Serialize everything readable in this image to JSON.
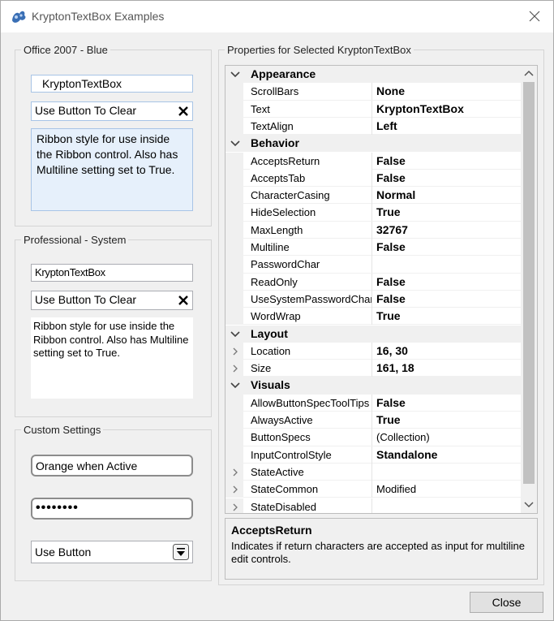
{
  "window": {
    "title": "KryptonTextBox Examples"
  },
  "office_group": {
    "legend": "Office 2007 - Blue",
    "textbox1": "KryptonTextBox",
    "textbox2": "Use Button To Clear",
    "multiline": "Ribbon style for use inside the Ribbon control. Also has Multiline setting set to True."
  },
  "professional_group": {
    "legend": "Professional - System",
    "textbox1": "KryptonTextBox",
    "textbox2": "Use Button To Clear",
    "multiline": "Ribbon style for use inside the Ribbon control. Also has Multiline setting set to True."
  },
  "custom_group": {
    "legend": "Custom Settings",
    "textbox1": "Orange when Active",
    "password": "••••••••",
    "textbox3": "Use Button"
  },
  "properties_group": {
    "legend": "Properties for Selected KryptonTextBox"
  },
  "property_grid": {
    "rows": [
      {
        "kind": "cat",
        "label": "Appearance"
      },
      {
        "kind": "prop",
        "name": "ScrollBars",
        "value": "None",
        "bold": true
      },
      {
        "kind": "prop",
        "name": "Text",
        "value": "KryptonTextBox",
        "bold": true
      },
      {
        "kind": "prop",
        "name": "TextAlign",
        "value": "Left",
        "bold": true
      },
      {
        "kind": "cat",
        "label": "Behavior"
      },
      {
        "kind": "prop",
        "name": "AcceptsReturn",
        "value": "False",
        "bold": true,
        "selected": true
      },
      {
        "kind": "prop",
        "name": "AcceptsTab",
        "value": "False",
        "bold": true
      },
      {
        "kind": "prop",
        "name": "CharacterCasing",
        "value": "Normal",
        "bold": true
      },
      {
        "kind": "prop",
        "name": "HideSelection",
        "value": "True",
        "bold": true
      },
      {
        "kind": "prop",
        "name": "MaxLength",
        "value": "32767",
        "bold": true
      },
      {
        "kind": "prop",
        "name": "Multiline",
        "value": "False",
        "bold": true
      },
      {
        "kind": "prop",
        "name": "PasswordChar",
        "value": "",
        "bold": true
      },
      {
        "kind": "prop",
        "name": "ReadOnly",
        "value": "False",
        "bold": true
      },
      {
        "kind": "prop",
        "name": "UseSystemPasswordChar",
        "value": "False",
        "bold": true
      },
      {
        "kind": "prop",
        "name": "WordWrap",
        "value": "True",
        "bold": true
      },
      {
        "kind": "cat",
        "label": "Layout"
      },
      {
        "kind": "prop",
        "name": "Location",
        "value": "16, 30",
        "bold": true,
        "expandable": true
      },
      {
        "kind": "prop",
        "name": "Size",
        "value": "161, 18",
        "bold": true,
        "expandable": true
      },
      {
        "kind": "cat",
        "label": "Visuals"
      },
      {
        "kind": "prop",
        "name": "AllowButtonSpecToolTips",
        "value": "False",
        "bold": true
      },
      {
        "kind": "prop",
        "name": "AlwaysActive",
        "value": "True",
        "bold": true
      },
      {
        "kind": "prop",
        "name": "ButtonSpecs",
        "value": "(Collection)",
        "bold": false
      },
      {
        "kind": "prop",
        "name": "InputControlStyle",
        "value": "Standalone",
        "bold": true
      },
      {
        "kind": "prop",
        "name": "StateActive",
        "value": "",
        "bold": false,
        "expandable": true
      },
      {
        "kind": "prop",
        "name": "StateCommon",
        "value": "Modified",
        "bold": false,
        "expandable": true
      },
      {
        "kind": "prop",
        "name": "StateDisabled",
        "value": "",
        "bold": false,
        "expandable": true
      }
    ]
  },
  "help": {
    "title": "AcceptsReturn",
    "description": "Indicates if return characters are accepted as input for multiline edit controls."
  },
  "footer": {
    "close_label": "Close"
  },
  "colors": {
    "office_border": "#a8c4e6",
    "office_multiline_bg": "#e6f0fb",
    "category_bg": "#f0f0f0",
    "window_bg": "#f0f0f0"
  },
  "icons": {
    "app": "krypton-app-icon",
    "close": "close-icon",
    "clear": "clear-x-icon",
    "dropdown": "dropdown-button-icon"
  }
}
